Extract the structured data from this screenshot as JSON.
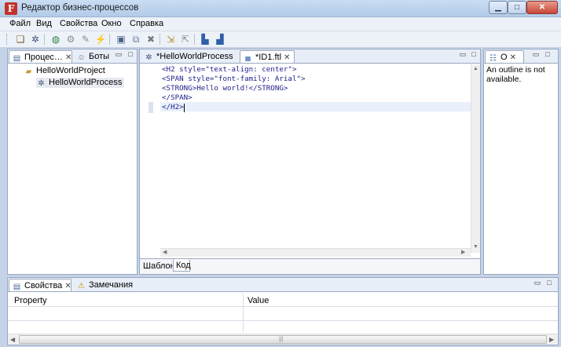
{
  "window": {
    "title": "Редактор бизнес-процессов",
    "app_icon_glyph": "F",
    "controls": [
      "minimize",
      "maximize",
      "close"
    ]
  },
  "menu": [
    "Файл",
    "Вид",
    "Свойства",
    "Окно",
    "Справка"
  ],
  "toolbar_icons": [
    "new-process-icon",
    "new-bot-icon",
    "globe-icon",
    "plugin-icon",
    "edit-icon",
    "delete-icon",
    "save-icon",
    "save-all-icon",
    "close-icon",
    "import-icon",
    "export-icon",
    "deploy-icon",
    "deploy-alt-icon"
  ],
  "left_panel": {
    "tabs": [
      {
        "label": "Процес…",
        "active": true
      },
      {
        "label": "Боты",
        "active": false
      }
    ],
    "tree": [
      {
        "label": "HelloWorldProject",
        "icon": "folder-icon",
        "level": 0
      },
      {
        "label": "HelloWorldProcess",
        "icon": "process-icon",
        "level": 1,
        "selected": true
      }
    ]
  },
  "editor": {
    "tabs": [
      {
        "label": "*HelloWorldProcess",
        "active": false
      },
      {
        "label": "*ID1.ftl",
        "active": true
      }
    ],
    "lines": [
      "<H2 style=\"text-align: center\">",
      "<SPAN style=\"font-family: Arial\">",
      "<STRONG>Hello world!</STRONG>",
      "</SPAN>",
      "</H2>"
    ],
    "bottom_tabs": [
      {
        "label": "Шаблон",
        "active": false
      },
      {
        "label": "Код",
        "active": true
      }
    ]
  },
  "outline": {
    "tab_label": "O",
    "message": "An outline is not available."
  },
  "bottom_panel": {
    "tabs": [
      {
        "label": "Свойства",
        "active": true
      },
      {
        "label": "Замечания",
        "active": false
      }
    ],
    "columns": [
      "Property",
      "Value"
    ]
  },
  "colors": {
    "accent": "#c4d3e8",
    "code": "#1f1f8a",
    "panel_border": "#9aa9c0"
  }
}
